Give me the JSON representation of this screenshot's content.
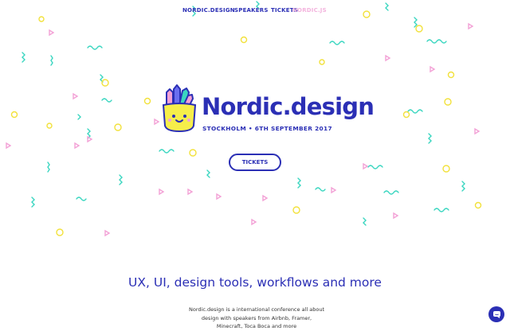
{
  "nav": {
    "items": [
      {
        "label": "NORDIC.DESIGN"
      },
      {
        "label": "SPEAKERS"
      },
      {
        "label": "TICKETS"
      },
      {
        "label": "NORDIC.JS"
      }
    ]
  },
  "hero": {
    "brand": "Nordic.design",
    "tagline": "STOCKHOLM • 6TH SEPTEMBER 2017",
    "cta_label": "TICKETS"
  },
  "main": {
    "title": "UX, UI, design tools, workflows and more",
    "intro": "Nordic.design is a international conference all about design with speakers from Airbnb, Framer, Minecraft, Toca Boca and more"
  },
  "colors": {
    "brand": "#2b2fb5",
    "pink": "#f3a1d6",
    "yellow": "#f6ee4a",
    "teal": "#3ad6c0"
  },
  "icons": {
    "logo": "pencil-cup-mascot-icon",
    "chat": "chat-bubble-icon"
  }
}
